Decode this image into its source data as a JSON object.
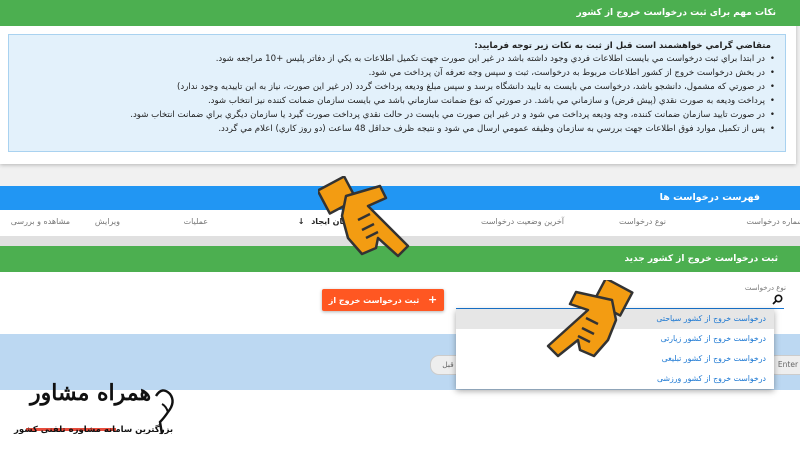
{
  "notice": {
    "header": "نکات مهم برای ثبت درخواست خروج از کشور",
    "intro": "متقاضي گرامي خواهشمند است قبل از ثبت به نكات زير توجه فرمایید:",
    "lines": [
      "در ابتدا براي ثبت درخواست مي بايست اطلاعات فردي وجود داشته باشد در غير اين صورت جهت تكميل اطلاعات به يكي از دفاتر پليس +10 مراجعه شود.",
      "در بخش درخواست خروج از كشور اطلاعات مربوط به درخواست، ثبت و سپس وجه تعرفه آن پرداخت مي شود.",
      "در صورتي كه مشمول، دانشجو باشد، درخواست مي بايست به تاييد دانشگاه برسد و سپس مبلغ وديعه پرداخت گردد (در غير اين صورت، نياز به اين تاييديه وجود ندارد)",
      "پرداخت وديعه به صورت نقدي (پيش فرض) و سازماني مي باشد. در صورتي كه نوع ضمانت سازماني باشد مي بايست سازمان ضمانت كننده نيز انتخاب شود.",
      "در صورت تاييد سازمان ضمانت كننده، وجه وديعه پرداخت مي شود و در غير اين صورت مي بايست در حالت نقدي پرداخت صورت گيرد يا سازمان ديگري براي ضمانت انتخاب شود.",
      "پس از تكميل موارد فوق اطلاعات جهت بررسي به سازمان وظيفه عمومي ارسال مي شود و نتيجه ظرف حداقل 48 ساعت (دو روز كاري) اعلام مي گردد."
    ]
  },
  "list": {
    "header": "فهرست درخواست ها",
    "columns": [
      "شماره درخواست",
      "نوع درخواست",
      "آخرین وضعیت درخواست",
      "زمان ایجاد",
      "عملیات",
      "ویرایش",
      "مشاهده و بررسی"
    ],
    "sort_arrow": "↓"
  },
  "new_request": {
    "header": "ثبت درخواست خروج از کشور جدید",
    "type_label": "نوع درخواست",
    "submit_label": "ثبت درخواست خروج از کشور",
    "submit_icon": "+",
    "options": [
      "درخواست خروج از کشور سیاحتی",
      "درخواست خروج از کشور زیارتی",
      "درخواست خروج از کشور تبلیغی",
      "درخواست خروج از کشور ورزشی"
    ]
  },
  "pager": {
    "enter_label": "Enter",
    "prev_label": "قبل"
  },
  "logo": {
    "title": "همراه مشاور",
    "subtitle": "بزرگترین سامانه مشاوره تلفنی کشور"
  },
  "colors": {
    "green": "#4caf50",
    "blue": "#2196f3",
    "orange": "#ff5722",
    "hand_orange": "#f39c12"
  }
}
